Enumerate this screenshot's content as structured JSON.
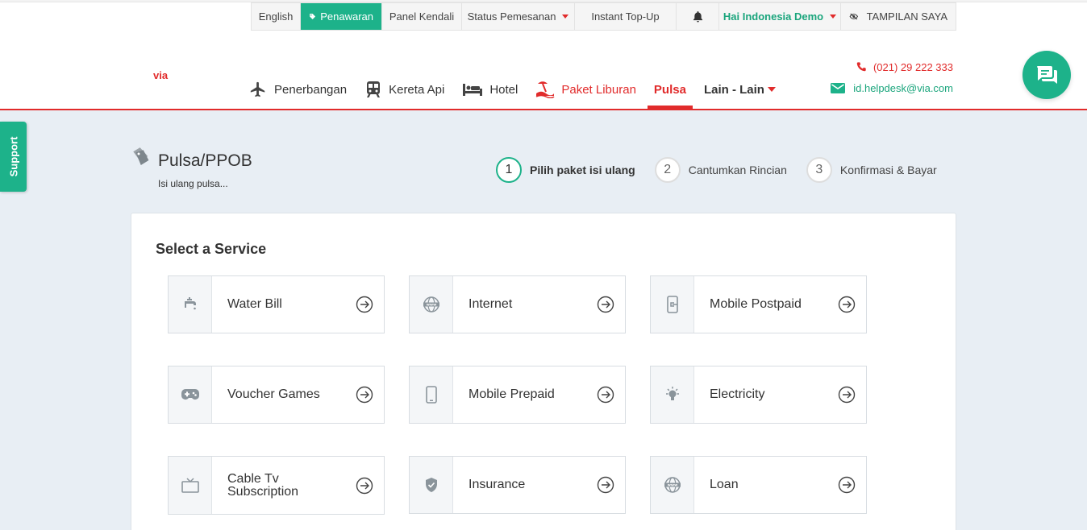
{
  "topbar": {
    "language": "English",
    "promo": "Penawaran",
    "dashboard": "Panel Kendali",
    "booking_status": "Status Pemesanan",
    "instant_topup": "Instant Top-Up",
    "user": "Hai Indonesia Demo",
    "view_mode": "TAMPILAN SAYA"
  },
  "logo": {
    "text": "via"
  },
  "nav": {
    "flights": "Penerbangan",
    "trains": "Kereta Api",
    "hotel": "Hotel",
    "holiday": "Paket Liburan",
    "pulsa": "Pulsa",
    "others": "Lain - Lain"
  },
  "contact": {
    "phone": "(021) 29 222 333",
    "email": "id.helpdesk@via.com"
  },
  "support": {
    "label": "Support"
  },
  "page": {
    "title": "Pulsa/PPOB",
    "subtitle": "Isi ulang pulsa..."
  },
  "steps": [
    {
      "num": "1",
      "label": "Pilih paket isi ulang"
    },
    {
      "num": "2",
      "label": "Cantumkan Rincian"
    },
    {
      "num": "3",
      "label": "Konfirmasi & Bayar"
    }
  ],
  "services": {
    "title": "Select a Service",
    "items": [
      {
        "label": "Water Bill",
        "icon": "water-tap-icon"
      },
      {
        "label": "Internet",
        "icon": "www-globe-icon"
      },
      {
        "label": "Mobile Postpaid",
        "icon": "mobile-postpaid-icon"
      },
      {
        "label": "Voucher Games",
        "icon": "gamepad-icon"
      },
      {
        "label": "Mobile Prepaid",
        "icon": "mobile-phone-icon"
      },
      {
        "label": "Electricity",
        "icon": "lightbulb-icon"
      },
      {
        "label": "Cable Tv Subscription",
        "icon": "tv-icon"
      },
      {
        "label": "Insurance",
        "icon": "shield-icon"
      },
      {
        "label": "Loan",
        "icon": "www-globe-icon"
      }
    ]
  },
  "colors": {
    "accent_green": "#1db28a",
    "brand_red": "#e12b2b",
    "page_bg": "#e8eef4"
  }
}
